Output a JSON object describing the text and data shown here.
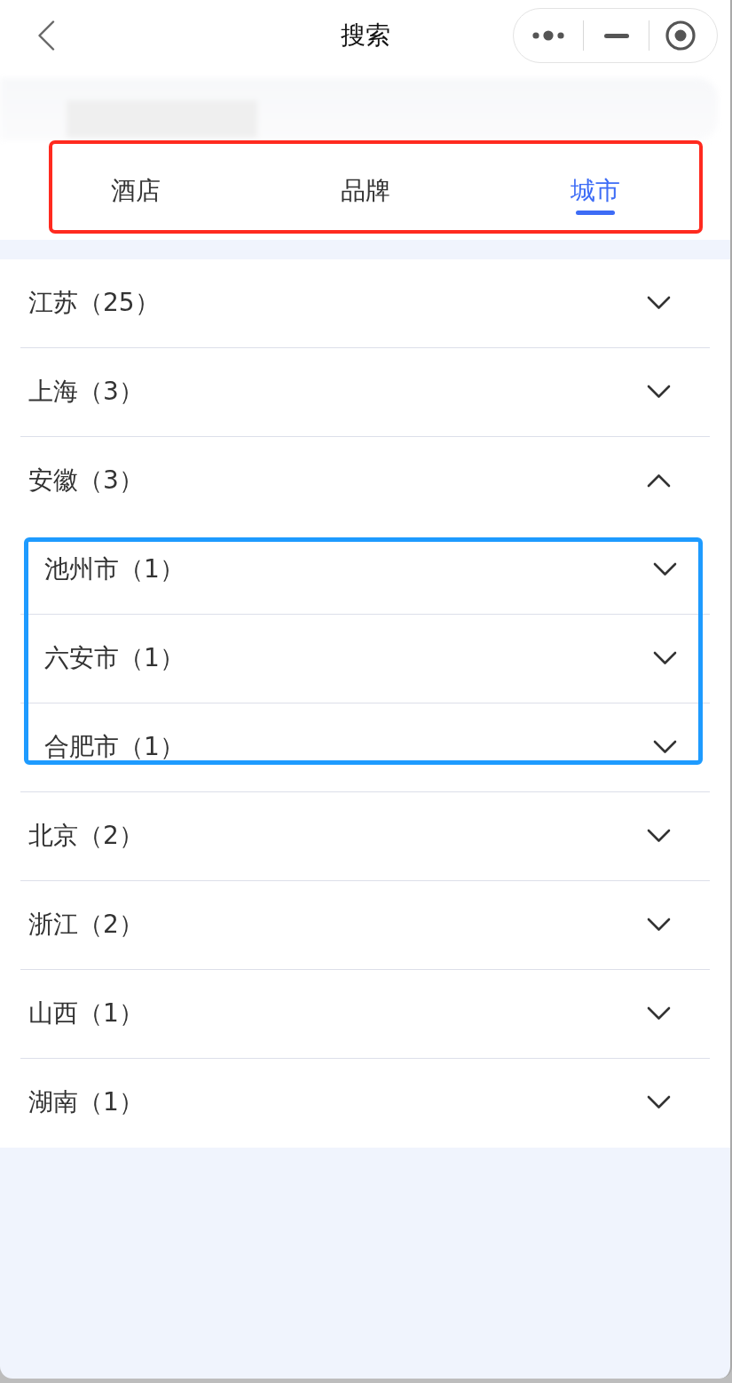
{
  "header": {
    "title": "搜索"
  },
  "tabs": [
    {
      "label": "酒店",
      "selected": false
    },
    {
      "label": "品牌",
      "selected": false
    },
    {
      "label": "城市",
      "selected": true
    }
  ],
  "provinces": [
    {
      "label": "江苏（25）",
      "expanded": false
    },
    {
      "label": "上海（3）",
      "expanded": false
    },
    {
      "label": "安徽（3）",
      "expanded": true,
      "children": [
        {
          "label": "池州市（1）",
          "expanded": false
        },
        {
          "label": "六安市（1）",
          "expanded": false
        },
        {
          "label": "合肥市（1）",
          "expanded": false
        }
      ]
    },
    {
      "label": "北京（2）",
      "expanded": false
    },
    {
      "label": "浙江（2）",
      "expanded": false
    },
    {
      "label": "山西（1）",
      "expanded": false
    },
    {
      "label": "湖南（1）",
      "expanded": false
    }
  ]
}
